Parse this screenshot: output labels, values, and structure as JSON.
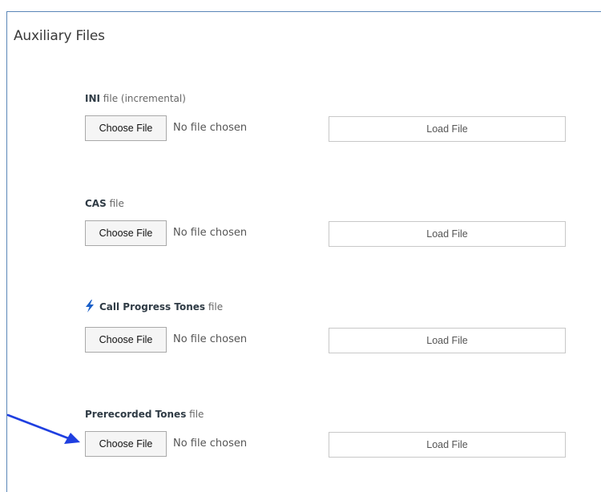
{
  "page": {
    "title": "Auxiliary Files"
  },
  "sections": [
    {
      "label_bold": "INI",
      "label_plain": " file (incremental)",
      "choose_label": "Choose File",
      "status": "No file chosen",
      "load_label": "Load File"
    },
    {
      "label_bold": "CAS",
      "label_plain": " file",
      "choose_label": "Choose File",
      "status": "No file chosen",
      "load_label": "Load File"
    },
    {
      "icon": "lightning-bolt-icon",
      "label_bold": "Call Progress Tones",
      "label_plain": " file",
      "choose_label": "Choose File",
      "status": "No file chosen",
      "load_label": "Load File"
    },
    {
      "label_bold": "Prerecorded Tones",
      "label_plain": " file",
      "choose_label": "Choose File",
      "status": "No file chosen",
      "load_label": "Load File"
    }
  ],
  "colors": {
    "frame_border": "#5a86b8",
    "bolt": "#1a5fc8",
    "arrow": "#1f3fe0"
  }
}
